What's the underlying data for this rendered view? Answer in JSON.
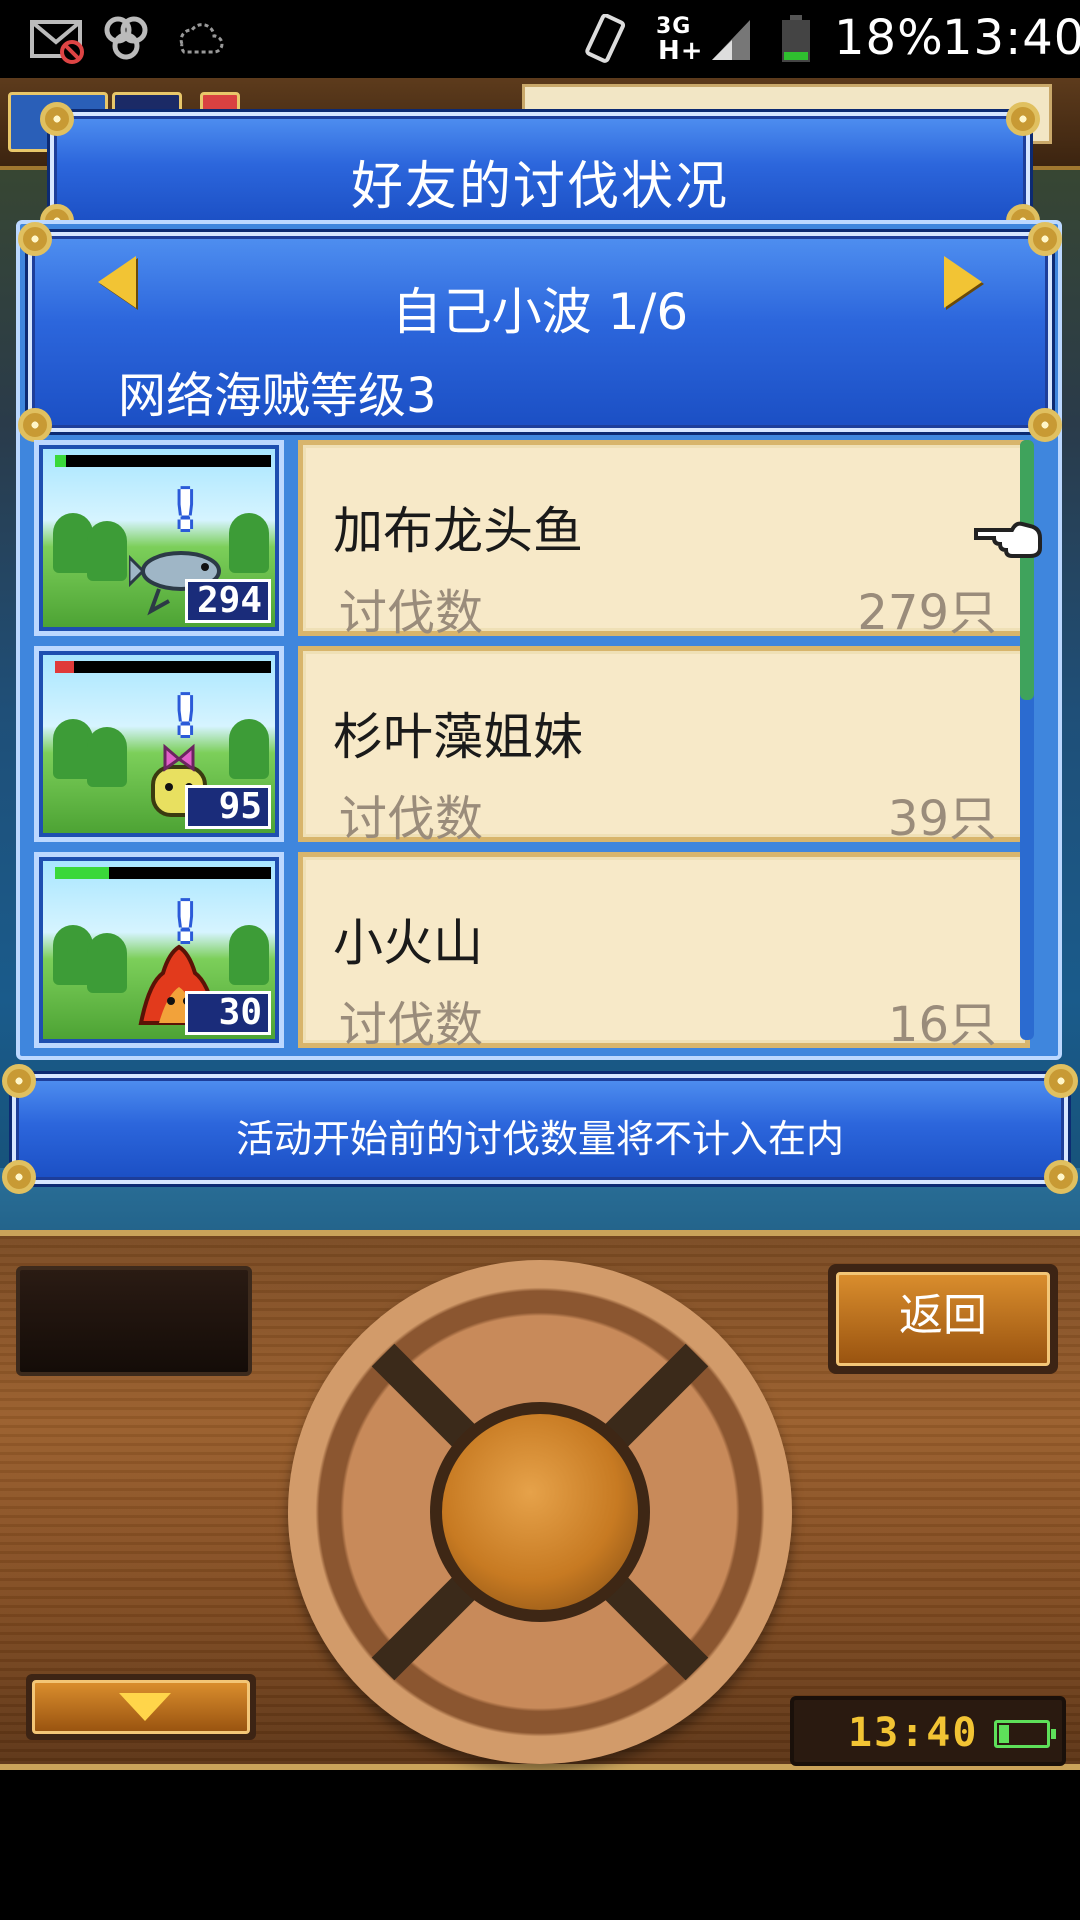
{
  "status_bar": {
    "battery_percent": "18%",
    "time": "13:40",
    "network": "3G",
    "network_sub": "H+",
    "icons": [
      "mail-muted-icon",
      "app-icon",
      "weather-icon",
      "vibrate-icon",
      "signal-icon",
      "battery-icon"
    ]
  },
  "dialog": {
    "title": "好友的讨伐状况",
    "player": {
      "name": "自己小波 1/6",
      "level_text": "网络海贼等级3"
    },
    "stat_label": "讨伐数",
    "monsters": [
      {
        "name": "加布龙头鱼",
        "count_text": "279只",
        "badge": "294",
        "hp_fraction": 0.05,
        "hp_color": "#3ad83a"
      },
      {
        "name": "杉叶藻姐妹",
        "count_text": "39只",
        "badge": "95",
        "hp_fraction": 0.09,
        "hp_color": "#e03a3a"
      },
      {
        "name": "小火山",
        "count_text": "16只",
        "badge": "30",
        "hp_fraction": 0.25,
        "hp_color": "#3ad83a"
      }
    ],
    "notice": "活动开始前的讨伐数量将不计入在内"
  },
  "controls": {
    "back_label": "返回",
    "clock": "13:40"
  },
  "colors": {
    "panel_blue": "#2c66dc",
    "card_bg": "#f7e9c8",
    "gold": "#f2c434",
    "wood": "#9a5e2b"
  }
}
